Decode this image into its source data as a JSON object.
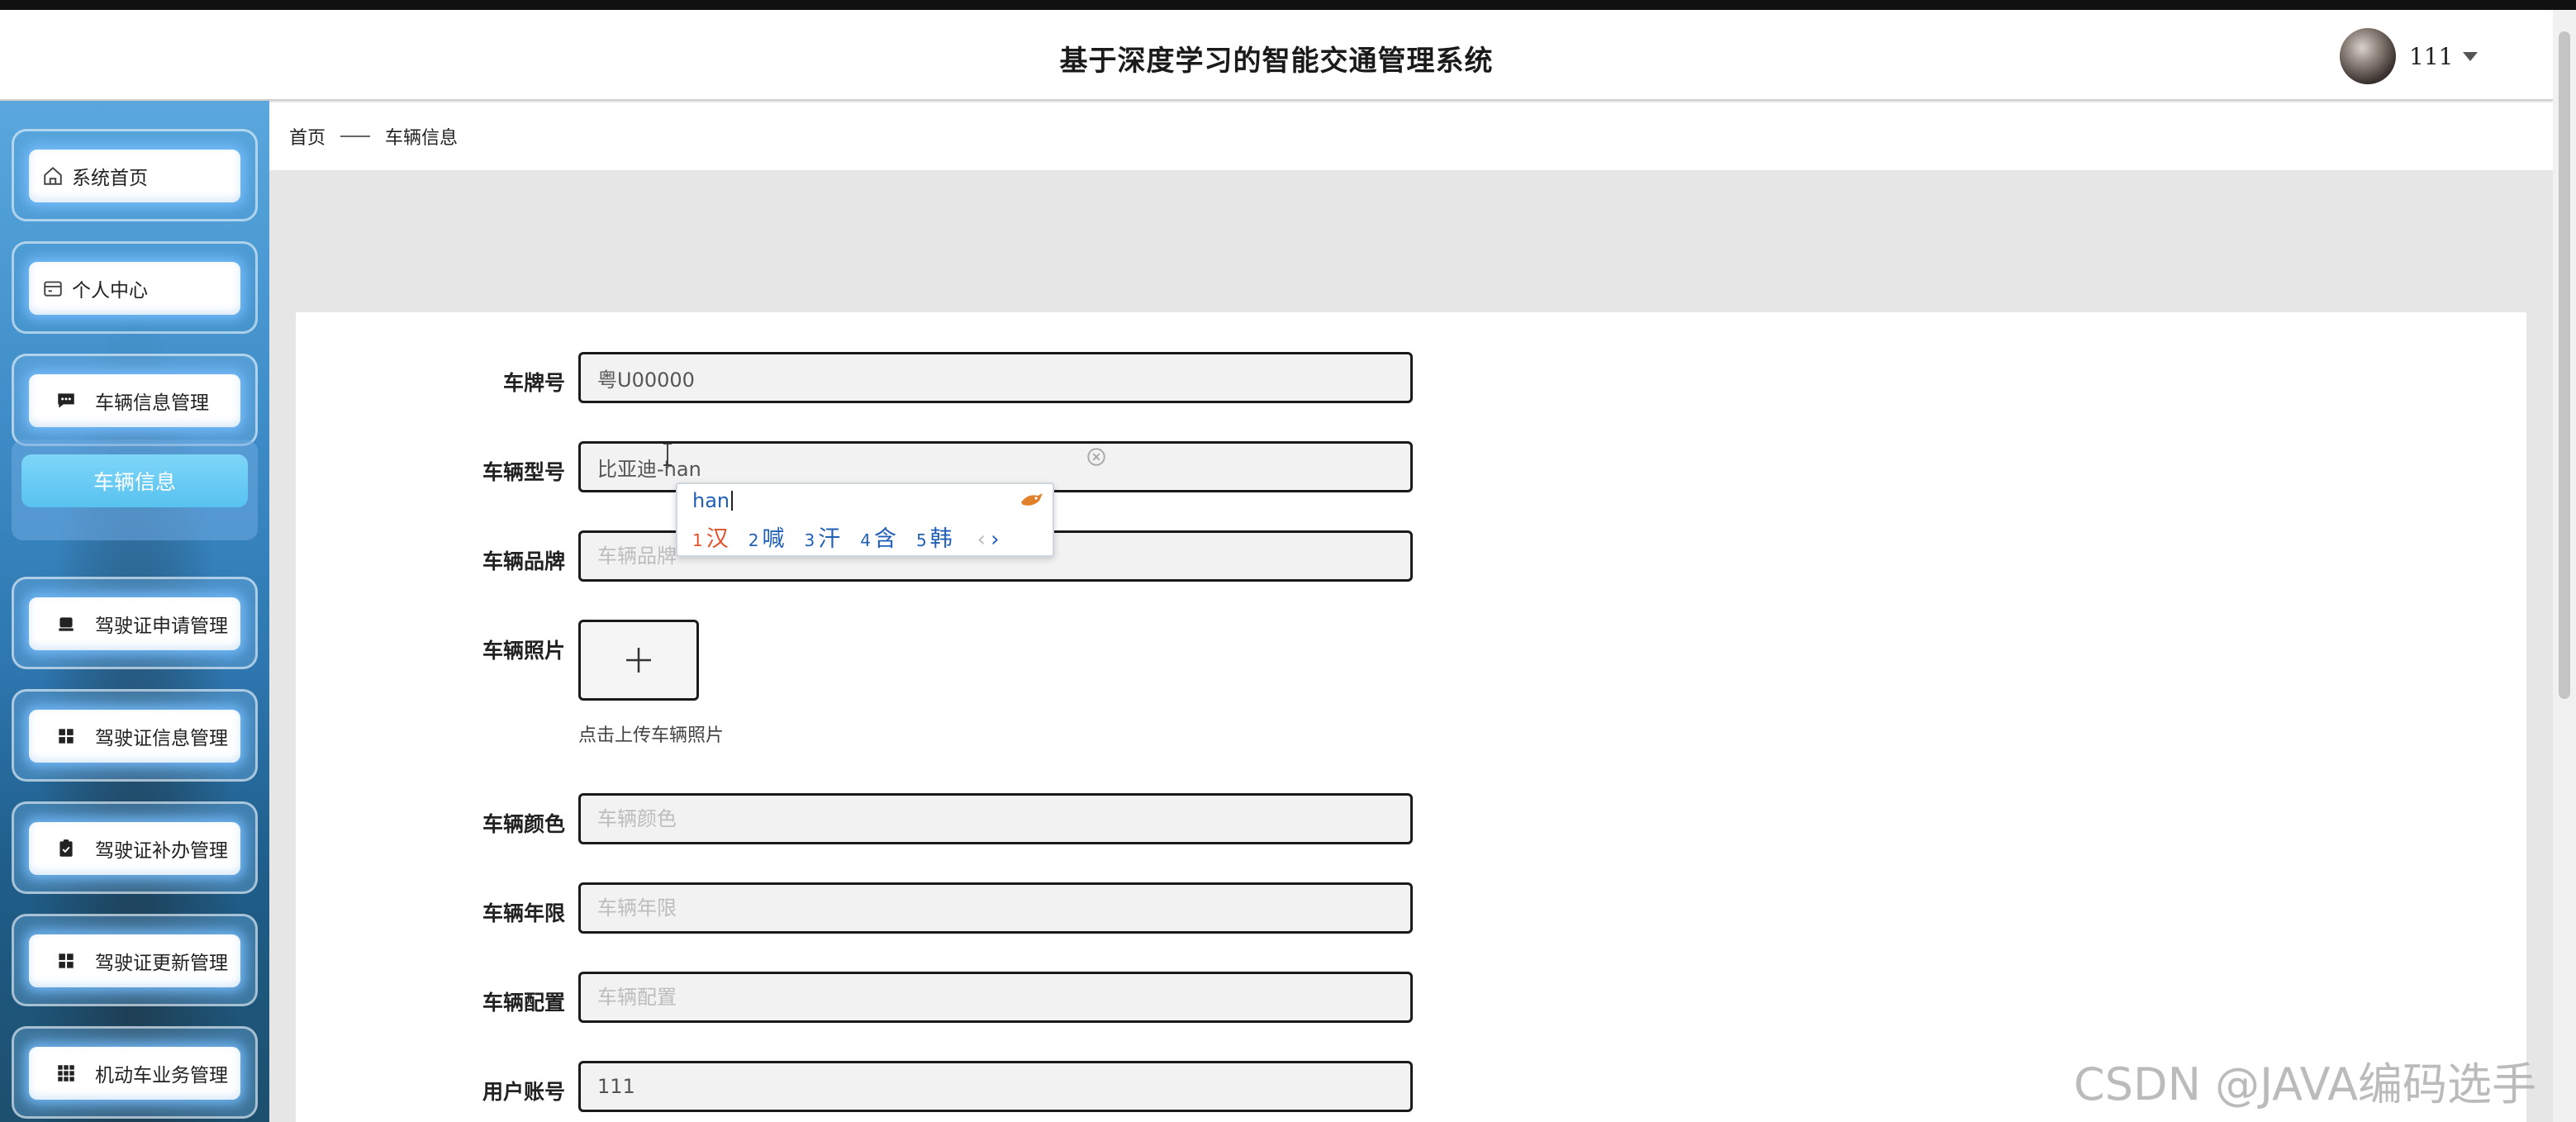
{
  "header": {
    "title": "基于深度学习的智能交通管理系统",
    "username": "111"
  },
  "sidebar": {
    "items": [
      {
        "label": "系统首页",
        "icon": "home-icon"
      },
      {
        "label": "个人中心",
        "icon": "wallet-icon"
      },
      {
        "label": "车辆信息管理",
        "icon": "chat-icon"
      },
      {
        "label": "驾驶证申请管理",
        "icon": "box-icon"
      },
      {
        "label": "驾驶证信息管理",
        "icon": "grid-icon"
      },
      {
        "label": "驾驶证补办管理",
        "icon": "clipboard-icon"
      },
      {
        "label": "驾驶证更新管理",
        "icon": "grid-icon"
      },
      {
        "label": "机动车业务管理",
        "icon": "apps-icon"
      }
    ],
    "active_sub": "车辆信息"
  },
  "breadcrumb": {
    "home": "首页",
    "current": "车辆信息"
  },
  "form": {
    "plate": {
      "label": "车牌号",
      "value": "粤U00000"
    },
    "model": {
      "label": "车辆型号",
      "value": "比亚迪-han"
    },
    "brand": {
      "label": "车辆品牌",
      "placeholder": "车辆品牌"
    },
    "photo": {
      "label": "车辆照片",
      "hint": "点击上传车辆照片"
    },
    "color": {
      "label": "车辆颜色",
      "placeholder": "车辆颜色"
    },
    "years": {
      "label": "车辆年限",
      "placeholder": "车辆年限"
    },
    "config": {
      "label": "车辆配置",
      "placeholder": "车辆配置"
    },
    "account": {
      "label": "用户账号",
      "value": "111"
    }
  },
  "ime": {
    "composition": "han",
    "candidates": [
      {
        "num": "1",
        "char": "汉"
      },
      {
        "num": "2",
        "char": "喊"
      },
      {
        "num": "3",
        "char": "汗"
      },
      {
        "num": "4",
        "char": "含"
      },
      {
        "num": "5",
        "char": "韩"
      }
    ],
    "prev": "‹",
    "next": "›"
  },
  "watermark": "CSDN @JAVA编码选手"
}
